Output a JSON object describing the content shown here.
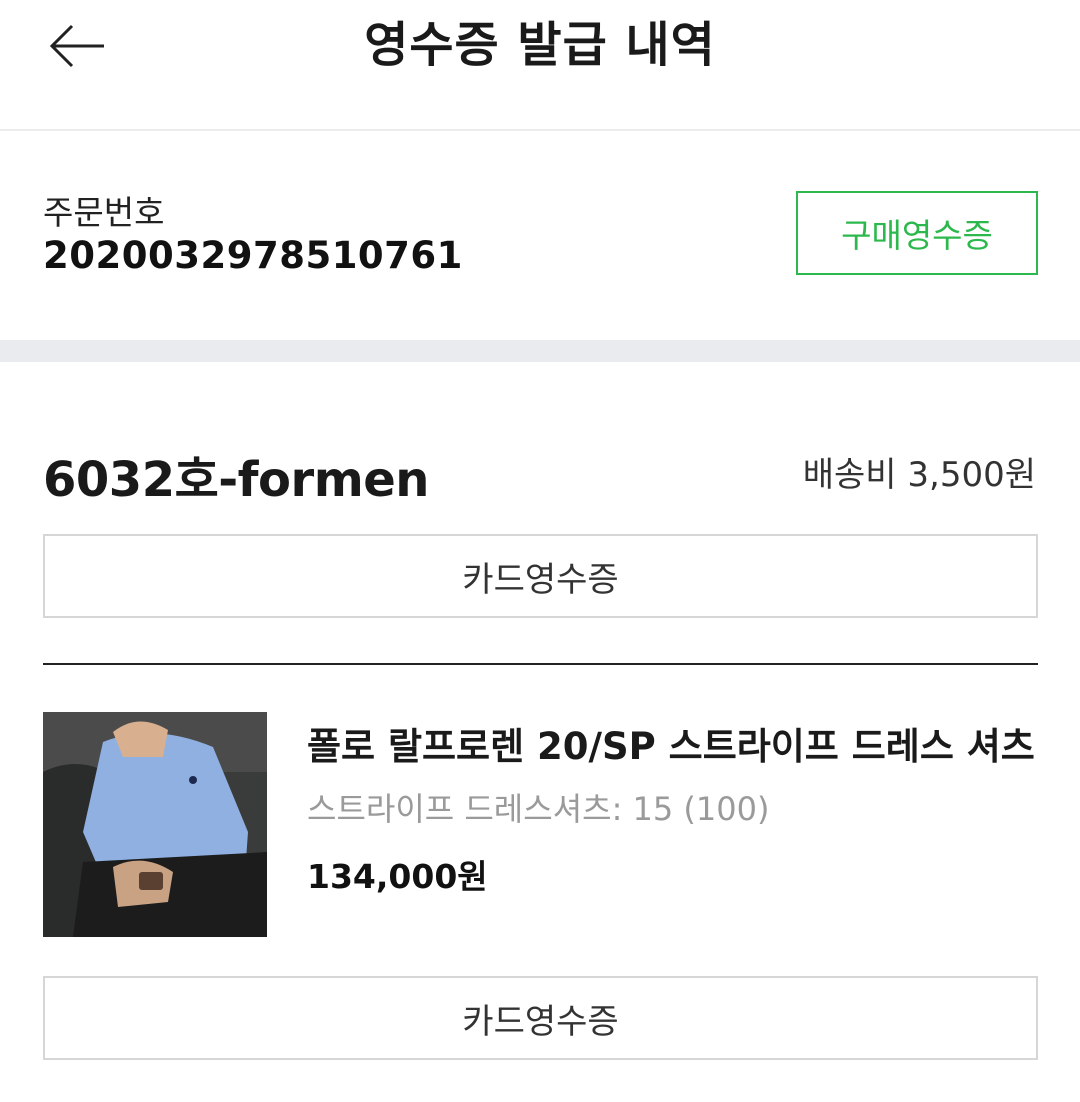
{
  "header": {
    "title": "영수증 발급 내역",
    "back_icon": "arrow-left-icon"
  },
  "order": {
    "label": "주문번호",
    "number": "202003297851076​1",
    "purchase_receipt_label": "구매영수증",
    "accent_color": "#2db84d"
  },
  "seller": {
    "name": "6032호-formen",
    "shipping_fee": "배송비 3,500원",
    "card_receipt_label": "카드영수증"
  },
  "item": {
    "name": "폴로 랄프로렌 20/SP 스트라이프 드레스 셔츠",
    "option": "스트라이프 드레스셔츠: 15 (100)",
    "price": "134,000원",
    "card_receipt_label": "카드영수증"
  }
}
